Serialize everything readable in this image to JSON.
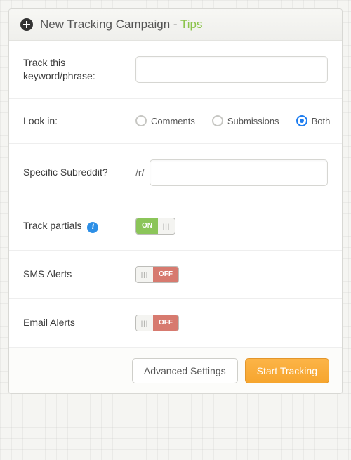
{
  "header": {
    "title": "New Tracking Campaign",
    "separator": " - ",
    "tips": "Tips"
  },
  "fields": {
    "keyword": {
      "label": "Track this keyword/phrase:",
      "value": ""
    },
    "look_in": {
      "label": "Look in:",
      "options": {
        "comments": "Comments",
        "submissions": "Submissions",
        "both": "Both"
      },
      "selected": "both"
    },
    "subreddit": {
      "label": "Specific Subreddit?",
      "prefix": "/r/",
      "value": ""
    },
    "track_partials": {
      "label": "Track partials",
      "on_text": "ON",
      "value": true
    },
    "sms_alerts": {
      "label": "SMS Alerts",
      "off_text": "OFF",
      "value": false
    },
    "email_alerts": {
      "label": "Email Alerts",
      "off_text": "OFF",
      "value": false
    }
  },
  "footer": {
    "advanced": "Advanced Settings",
    "start": "Start Tracking"
  }
}
